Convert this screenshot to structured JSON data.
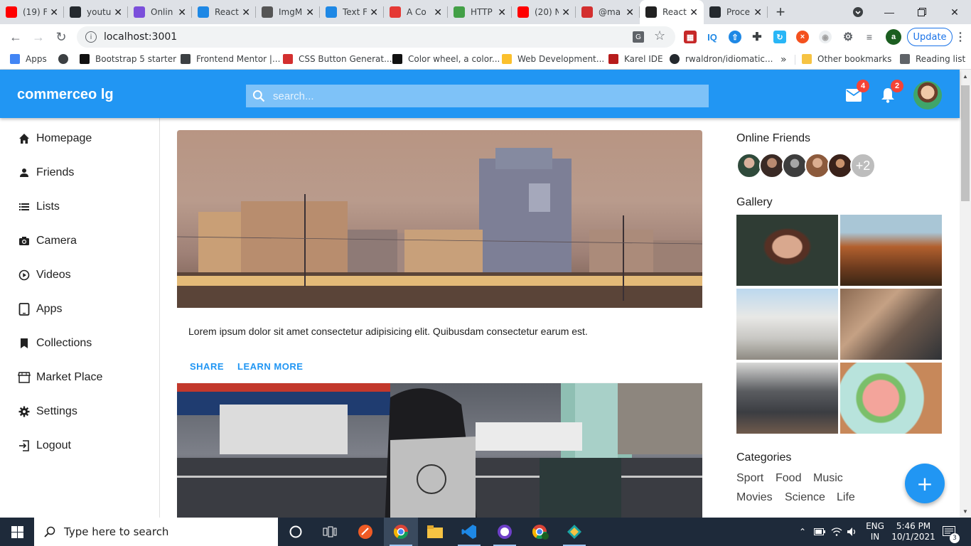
{
  "browser": {
    "tabs": [
      {
        "label": "(19) F",
        "icon": "youtube-icon",
        "color": "#ff0000"
      },
      {
        "label": "youtu",
        "icon": "github-icon",
        "color": "#24292e"
      },
      {
        "label": "Onlin",
        "icon": "online-icon",
        "color": "#7b4fdb"
      },
      {
        "label": "React",
        "icon": "mui-icon",
        "color": "#1e88e5"
      },
      {
        "label": "ImgM",
        "icon": "cube-icon",
        "color": "#555555"
      },
      {
        "label": "Text F",
        "icon": "mui-icon",
        "color": "#1e88e5"
      },
      {
        "label": "A Co",
        "icon": "asterisk-icon",
        "color": "#e53935"
      },
      {
        "label": "HTTP",
        "icon": "node-icon",
        "color": "#43a047"
      },
      {
        "label": "(20) N",
        "icon": "youtube-icon",
        "color": "#ff0000"
      },
      {
        "label": "@ma",
        "icon": "brand-icon",
        "color": "#d32f2f"
      },
      {
        "label": "React",
        "icon": "react-icon",
        "color": "#222222",
        "active": true
      },
      {
        "label": "Proce",
        "icon": "github-icon",
        "color": "#24292e"
      }
    ],
    "url": "localhost:3001",
    "update_label": "Update",
    "profile_initial": "a",
    "bookmarks": [
      {
        "label": "Apps",
        "icon": "apps-grid-icon"
      },
      {
        "label": "",
        "icon": "globe-icon"
      },
      {
        "label": "Bootstrap 5 starter",
        "icon": "bootstrap-icon"
      },
      {
        "label": "Frontend Mentor |...",
        "icon": "frontend-mentor-icon"
      },
      {
        "label": "CSS Button Generat...",
        "icon": "star-burst-icon"
      },
      {
        "label": "Color wheel, a color...",
        "icon": "color-wheel-icon"
      },
      {
        "label": "Web Development...",
        "icon": "bulb-icon"
      },
      {
        "label": "Karel IDE",
        "icon": "stanford-icon"
      },
      {
        "label": "rwaldron/idiomatic...",
        "icon": "github-icon"
      },
      {
        "label": "Other bookmarks",
        "icon": "folder-icon"
      },
      {
        "label": "Reading list",
        "icon": "reading-list-icon"
      }
    ]
  },
  "app": {
    "logo": "commerceo lg",
    "search_placeholder": "search...",
    "mail_count": "4",
    "notification_count": "2"
  },
  "sidebar": {
    "items": [
      {
        "label": "Homepage",
        "icon": "home-icon"
      },
      {
        "label": "Friends",
        "icon": "person-icon"
      },
      {
        "label": "Lists",
        "icon": "list-icon"
      },
      {
        "label": "Camera",
        "icon": "camera-icon"
      },
      {
        "label": "Videos",
        "icon": "play-circle-icon"
      },
      {
        "label": "Apps",
        "icon": "tablet-icon"
      },
      {
        "label": "Collections",
        "icon": "bookmark-icon"
      },
      {
        "label": "Market Place",
        "icon": "storefront-icon"
      },
      {
        "label": "Settings",
        "icon": "gear-icon"
      },
      {
        "label": "Logout",
        "icon": "exit-icon"
      }
    ]
  },
  "feed": {
    "posts": [
      {
        "text": "Lorem ipsum dolor sit amet consectetur adipisicing elit. Quibusdam consectetur earum est.",
        "share": "SHARE",
        "learn_more": "LEARN MORE"
      }
    ]
  },
  "rightbar": {
    "online_title": "Online Friends",
    "online_more": "+2",
    "gallery_title": "Gallery",
    "categories_title": "Categories",
    "categories": [
      "Sport",
      "Food",
      "Music",
      "Movies",
      "Science",
      "Life"
    ]
  },
  "taskbar": {
    "search_placeholder": "Type here to search",
    "lang_line1": "ENG",
    "lang_line2": "IN",
    "time": "5:46 PM",
    "date": "10/1/2021",
    "notification_count": "3"
  },
  "colors": {
    "primary": "#2196f3",
    "badge": "#f44336"
  }
}
